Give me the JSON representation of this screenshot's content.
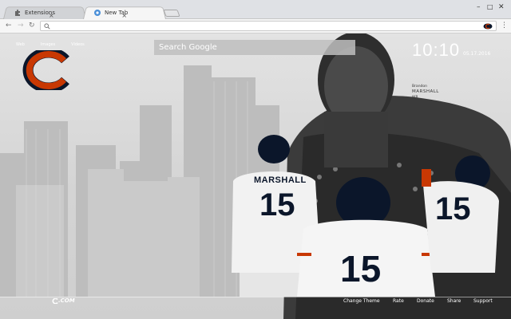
{
  "tabs": [
    {
      "title": "Extensions",
      "icon": "puzzle-icon",
      "active": false
    },
    {
      "title": "New Tab",
      "icon": "chrome-icon",
      "active": true
    }
  ],
  "address_value": "",
  "apps_links": [
    "Web",
    "Images",
    "Videos"
  ],
  "search": {
    "placeholder": "Search Google"
  },
  "clock": {
    "time": "10:10",
    "date": "05.17.2016"
  },
  "player": {
    "first": "Brandon",
    "last": "MARSHALL",
    "position": "WR"
  },
  "jersey": {
    "name": "MARSHALL",
    "number": "15"
  },
  "footer": {
    "brand": ".COM",
    "links": [
      "Change Theme",
      "Rate",
      "Donate",
      "Share",
      "Support"
    ]
  },
  "colors": {
    "navy": "#0b162a",
    "orange": "#c83803",
    "tab_active": "#f6f6f6"
  }
}
